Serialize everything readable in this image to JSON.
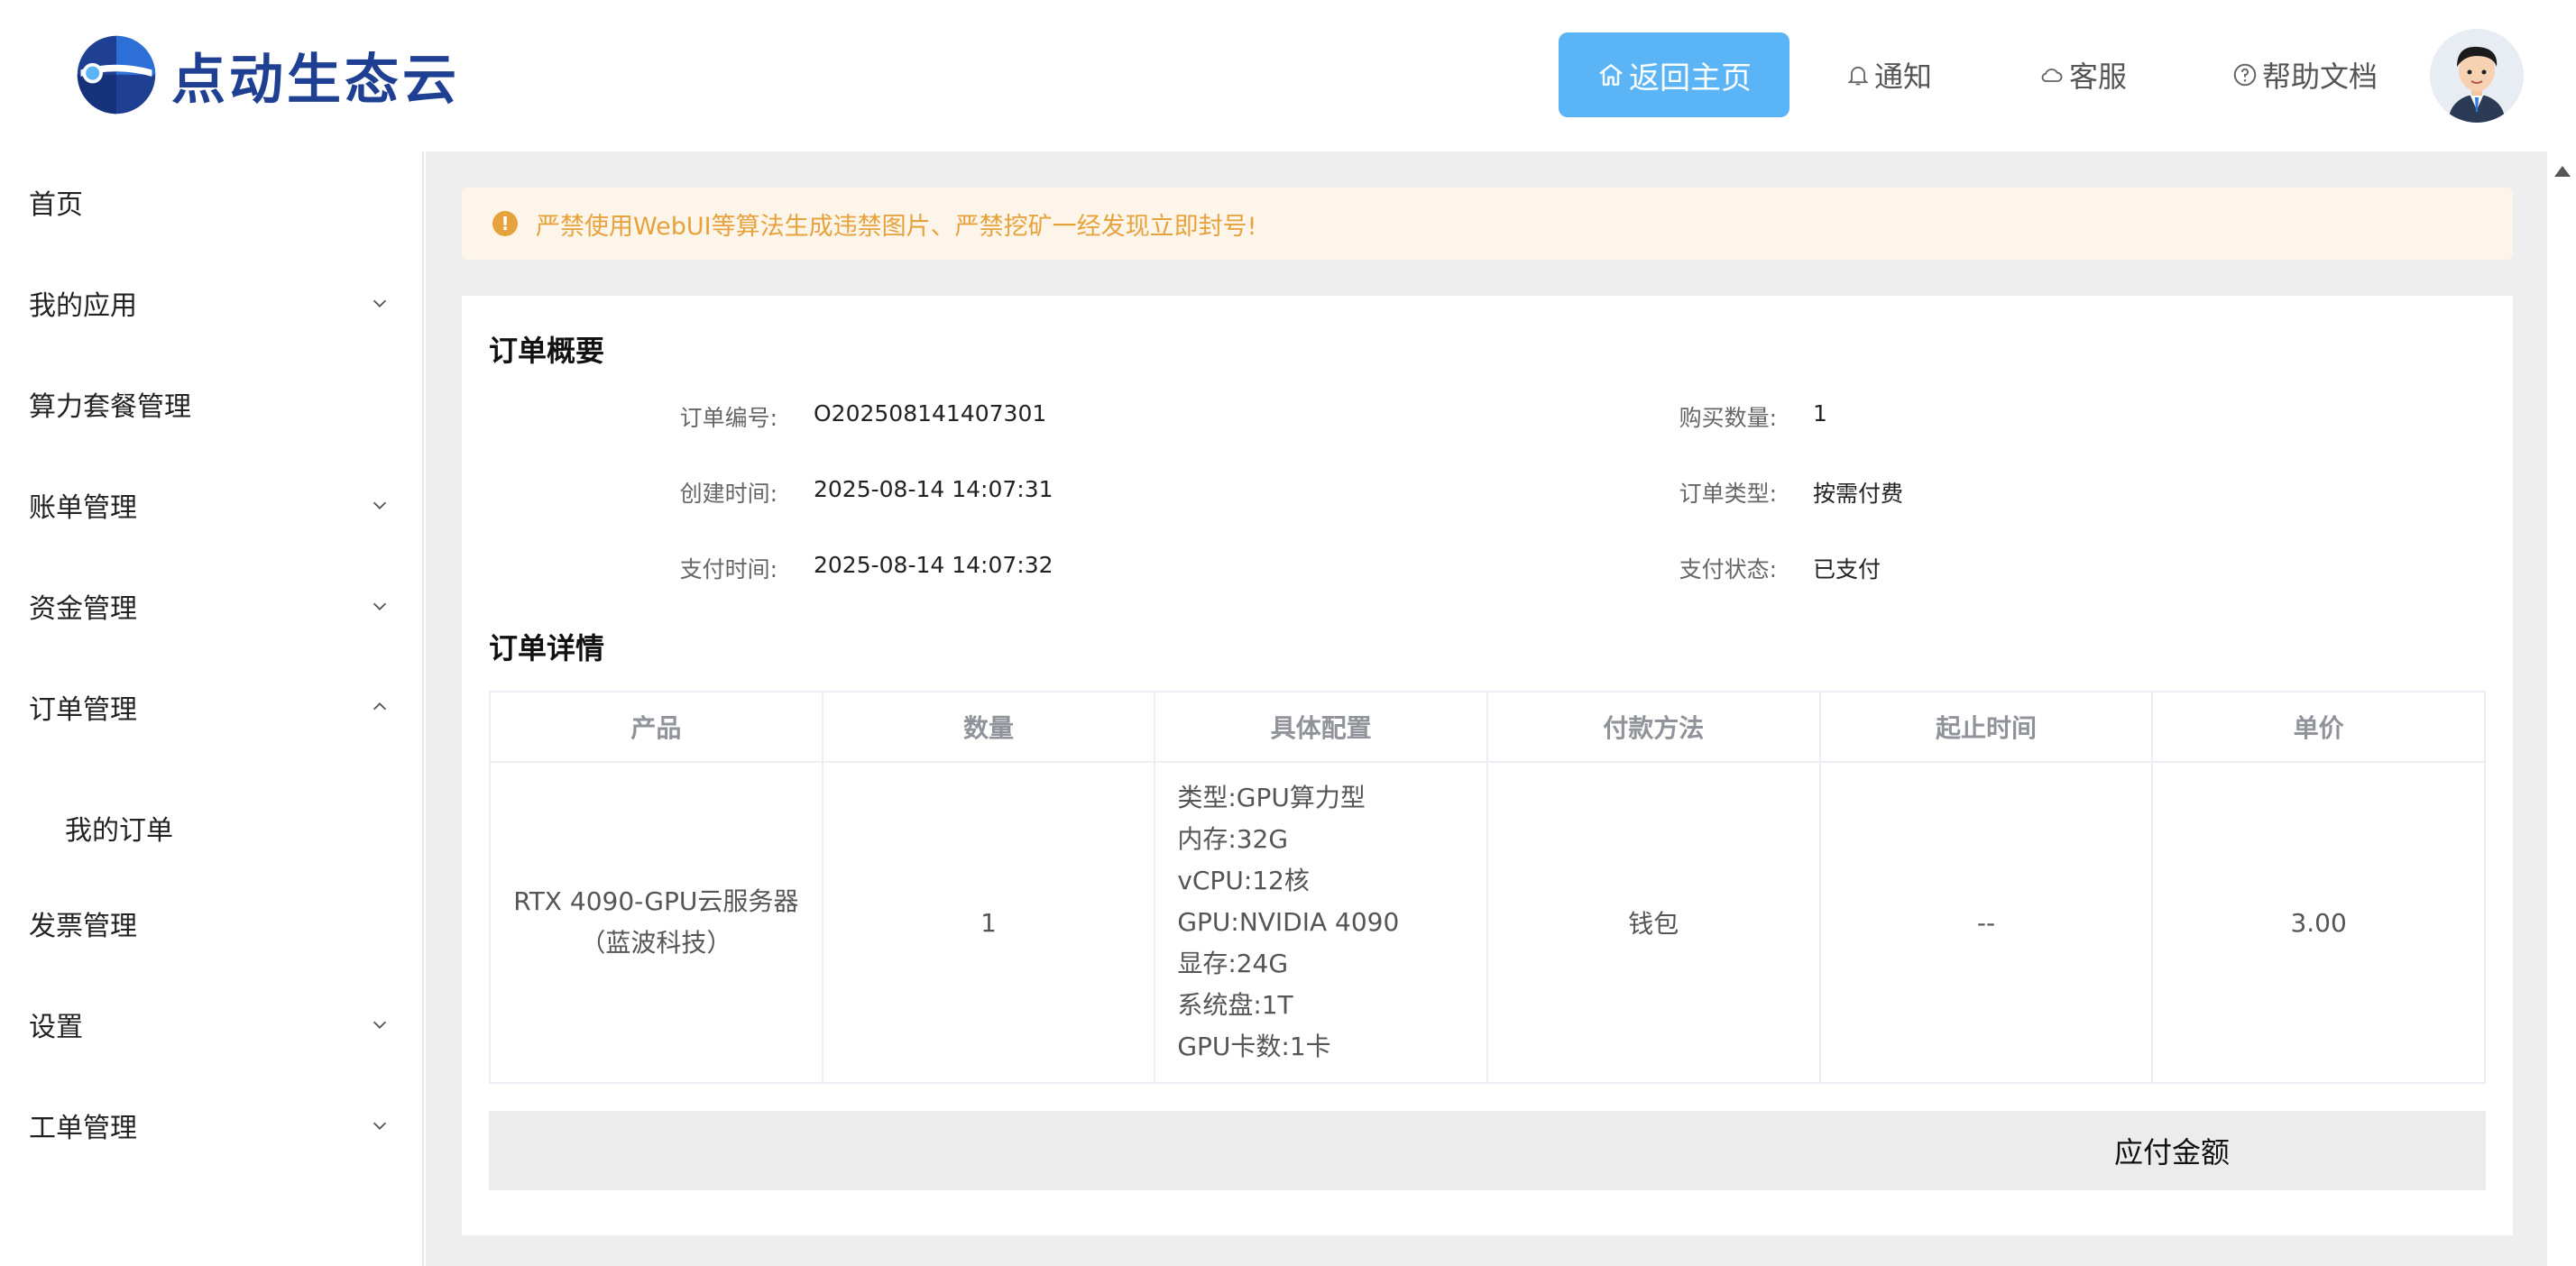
{
  "header": {
    "logo_text": "点动生态云",
    "nav": {
      "home": "返回主页",
      "notice": "通知",
      "service": "客服",
      "help": "帮助文档"
    }
  },
  "sidebar": {
    "items": [
      {
        "label": "首页"
      },
      {
        "label": "我的应用"
      },
      {
        "label": "算力套餐管理"
      },
      {
        "label": "账单管理"
      },
      {
        "label": "资金管理"
      },
      {
        "label": "订单管理"
      },
      {
        "label": "我的订单"
      },
      {
        "label": "发票管理"
      },
      {
        "label": "设置"
      },
      {
        "label": "工单管理"
      }
    ]
  },
  "alert": {
    "text": "严禁使用WebUI等算法生成违禁图片、严禁挖矿一经发现立即封号!"
  },
  "summary": {
    "title": "订单概要",
    "order_no_label": "订单编号:",
    "order_no": "O202508141407301",
    "created_label": "创建时间:",
    "created": "2025-08-14 14:07:31",
    "paid_label": "支付时间:",
    "paid": "2025-08-14 14:07:32",
    "qty_label": "购买数量:",
    "qty": "1",
    "type_label": "订单类型:",
    "type": "按需付费",
    "status_label": "支付状态:",
    "status": "已支付"
  },
  "detail": {
    "title": "订单详情",
    "columns": [
      "产品",
      "数量",
      "具体配置",
      "付款方法",
      "起止时间",
      "单价"
    ],
    "row": {
      "product_line1": "RTX 4090-GPU云服务器",
      "product_line2": "（蓝波科技）",
      "qty": "1",
      "config": [
        "类型:GPU算力型",
        "内存:32G",
        "vCPU:12核",
        "GPU:NVIDIA 4090",
        "显存:24G",
        "系统盘:1T",
        "GPU卡数:1卡"
      ],
      "pay_method": "钱包",
      "period": "--",
      "price": "3.00"
    },
    "total_label": "应付金额"
  },
  "colors": {
    "primary": "#5ab4f5",
    "warning": "#e6a23c",
    "warning_bg": "#fdf5e9",
    "brand": "#1f3f93"
  }
}
